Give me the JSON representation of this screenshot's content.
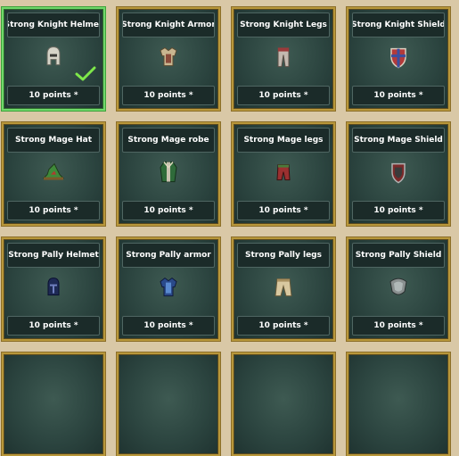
{
  "cards": [
    {
      "title": "Strong Knight Helmet",
      "points": "10 points *",
      "icon": "knight-helmet-icon",
      "selected": true
    },
    {
      "title": "Strong Knight Armor",
      "points": "10 points *",
      "icon": "knight-armor-icon"
    },
    {
      "title": "Strong Knight Legs",
      "points": "10 points *",
      "icon": "knight-legs-icon"
    },
    {
      "title": "Strong Knight Shield",
      "points": "10 points *",
      "icon": "knight-shield-icon"
    },
    {
      "title": "Strong Mage Hat",
      "points": "10 points *",
      "icon": "mage-hat-icon"
    },
    {
      "title": "Strong Mage robe",
      "points": "10 points *",
      "icon": "mage-robe-icon"
    },
    {
      "title": "Strong Mage legs",
      "points": "10 points *",
      "icon": "mage-legs-icon"
    },
    {
      "title": "Strong Mage Shield",
      "points": "10 points *",
      "icon": "mage-shield-icon"
    },
    {
      "title": "Strong Pally Helmet",
      "points": "10 points *",
      "icon": "pally-helmet-icon"
    },
    {
      "title": "Strong Pally armor",
      "points": "10 points *",
      "icon": "pally-armor-icon"
    },
    {
      "title": "Strong Pally legs",
      "points": "10 points *",
      "icon": "pally-legs-icon"
    },
    {
      "title": "Strong Pally Shield",
      "points": "10 points *",
      "icon": "pally-shield-icon"
    }
  ],
  "colors": {
    "page_bg": "#d9c8a6",
    "card_border": "#b8973a",
    "selected_border": "#6fd86a",
    "label_bg": "#1b2b29"
  }
}
